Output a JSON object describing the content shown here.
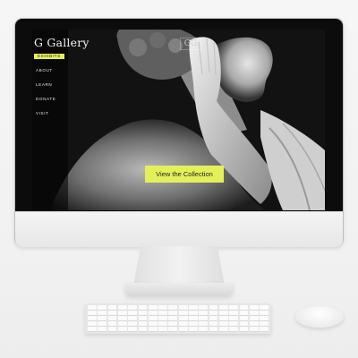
{
  "site": {
    "logo": "G Gallery",
    "brand_mark": "GG",
    "nav": [
      {
        "label": "EXHIBITS",
        "active": true
      },
      {
        "label": "ABOUT",
        "active": false
      },
      {
        "label": "LEARN",
        "active": false
      },
      {
        "label": "DONATE",
        "active": false
      },
      {
        "label": "VISIT",
        "active": false
      }
    ],
    "cta_label": "View the Collection"
  },
  "colors": {
    "accent": "#e3f05a",
    "screen_bg": "#111111",
    "desk": "#f2f2f2"
  },
  "icons": [
    "monitor-icon",
    "keyboard-icon",
    "mouse-icon"
  ]
}
